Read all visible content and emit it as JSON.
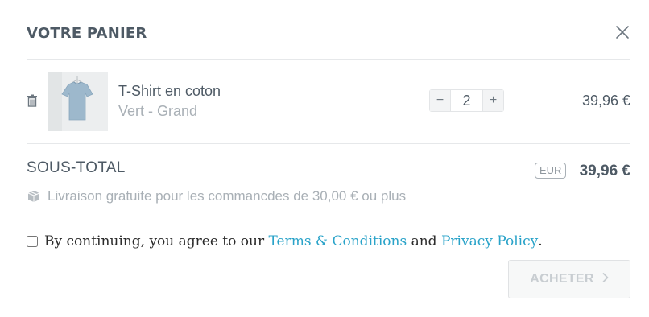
{
  "header": {
    "title": "VOTRE PANIER",
    "close_icon": "close-icon"
  },
  "item": {
    "name": "T-Shirt en coton",
    "variant": "Vert - Grand",
    "quantity": "2",
    "minus_label": "−",
    "plus_label": "+",
    "price": "39,96 €",
    "remove_icon": "trash-icon",
    "thumbnail": "t-shirt-photo"
  },
  "summary": {
    "subtotal_label": "SOUS-TOTAL",
    "currency": "EUR",
    "subtotal_value": "39,96 €",
    "shipping_icon": "box-icon",
    "shipping_text": "Livraison gratuite pour les commancdes de 30,00 € ou plus"
  },
  "agreement": {
    "prefix": "By continuing, you agree to our ",
    "terms_label": "Terms & Conditions",
    "middle": " and ",
    "privacy_label": "Privacy Policy",
    "suffix": "."
  },
  "checkout": {
    "buy_label": "ACHETER",
    "arrow_icon": "chevron-right-icon"
  },
  "colors": {
    "text": "#4e5a65",
    "muted": "#a9b0b6",
    "link": "#2aa3c9",
    "disabled_button_text": "#c8cdd1"
  }
}
